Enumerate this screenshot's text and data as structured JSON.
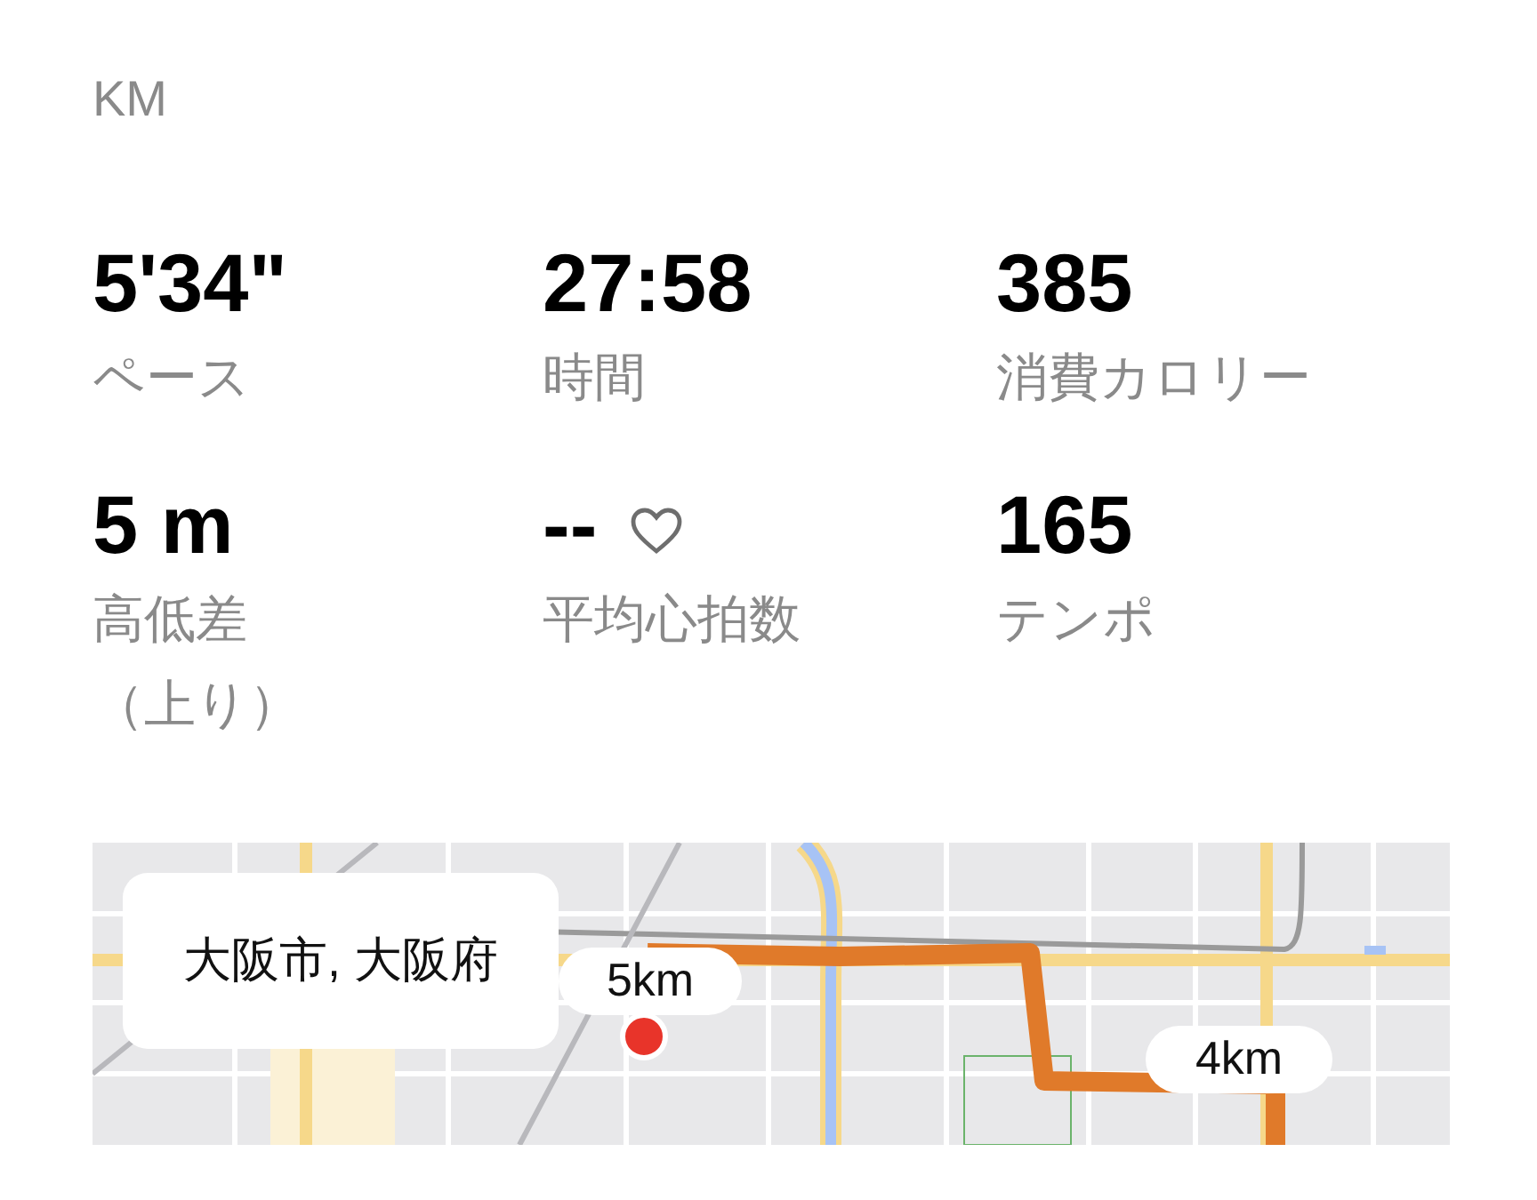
{
  "unit_label": "KM",
  "stats": [
    {
      "kind": "plain",
      "value": "5'34\"",
      "label": "ペース"
    },
    {
      "kind": "plain",
      "value": "27:58",
      "label": "時間"
    },
    {
      "kind": "plain",
      "value": "385",
      "label": "消費カロリー"
    },
    {
      "kind": "plain",
      "value": "5 m",
      "label": "高低差（上り）"
    },
    {
      "kind": "heart",
      "value": "--",
      "label": "平均心拍数"
    },
    {
      "kind": "plain",
      "value": "165",
      "label": "テンポ"
    }
  ],
  "map": {
    "kind": "picture",
    "location": "大阪市, 大阪府",
    "distance_markers": [
      {
        "label": "5km"
      },
      {
        "label": "4km"
      }
    ]
  }
}
